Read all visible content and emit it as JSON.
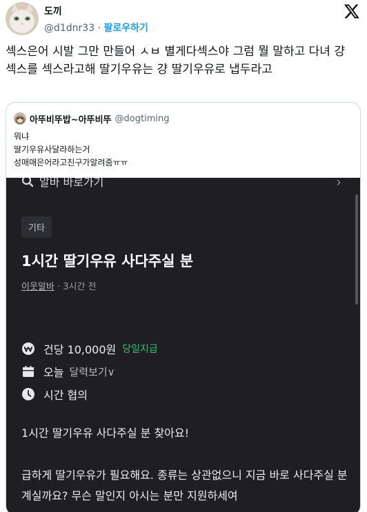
{
  "tweet": {
    "name": "도끼",
    "handle": "@d1dnr33",
    "separator": "·",
    "follow_label": "팔로우하기",
    "text": "섹스은어 시발 그만 만들어 ㅅㅂ 별게다섹스야 그럼 뭘 말하고 다녀 걍 섹스를 섹스라고해 딸기우유는 걍 딸기우유로 냅두라고"
  },
  "quote": {
    "name": "아뚜비뚜밥~아뚜비뚜",
    "handle": "@dogtiming",
    "lines": [
      "뭐냐",
      "딸기우유사달라하는거",
      "성매매은어라고친구가알려줌ㅠㅠ"
    ]
  },
  "screenshot": {
    "top_link": "알바 바로가기",
    "category": "기타",
    "title": "1시간 딸기우유 사다주실 분",
    "author": "이웃알바",
    "time_ago": "· 3시간 전",
    "pay": "건당 10,000원",
    "pay_badge": "당일지급",
    "date": "오늘",
    "calendar_link": "달력보기∨",
    "hours": "시간 협의",
    "desc_line1": "1시간 딸기우유 사다주실 분 찾아요!",
    "desc_line2": "급하게 딸기우유가 필요해요. 종류는 상관없으니 지금 바로 사다주실 분 계실까요? 무슨 말인지 아시는 분만 지원하세여"
  },
  "colors": {
    "follow": "#1d9bf0",
    "dark_bg": "#1f1f23",
    "same_day_pay": "#2fbf71"
  },
  "icons": {
    "logo": "x-logo-icon",
    "pay": "won-coin-icon",
    "date": "calendar-icon",
    "time": "clock-icon",
    "top": "search-icon"
  }
}
